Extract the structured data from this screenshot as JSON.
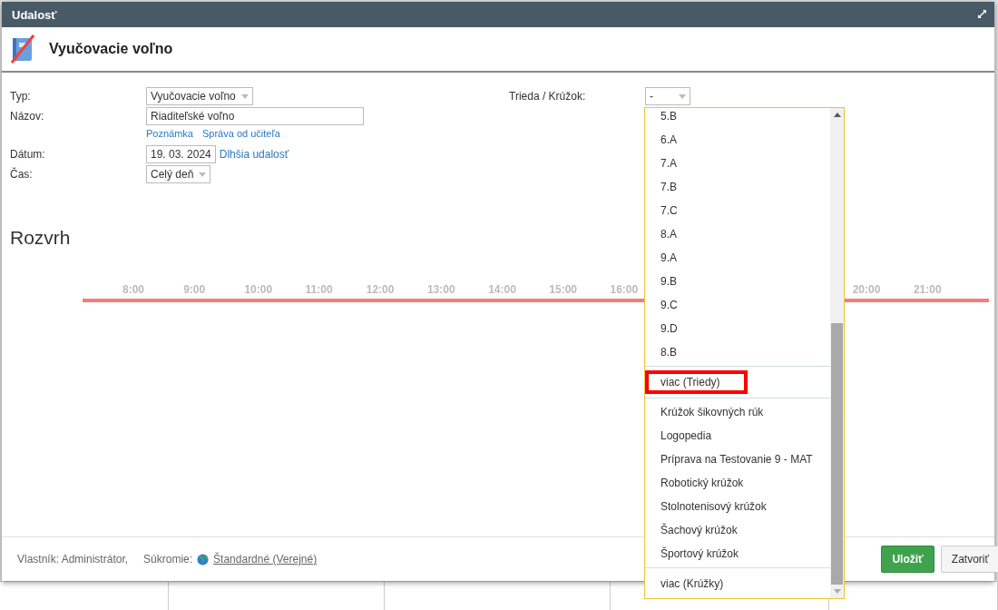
{
  "window": {
    "title": "Udalosť"
  },
  "header": {
    "title": "Vyučovacie voľno"
  },
  "form": {
    "type": {
      "label": "Typ:",
      "value": "Vyučovacie voľno"
    },
    "name": {
      "label": "Názov:",
      "value": "Riaditeľské voľno",
      "links": [
        "Poznámka",
        "Správa od učiteľa"
      ]
    },
    "date": {
      "label": "Dátum:",
      "value": "19. 03. 2024",
      "link": "Dlhšia udalosť"
    },
    "time": {
      "label": "Čas:",
      "value": "Celý deň"
    },
    "class": {
      "label": "Trieda / Krúžok:",
      "value": "-"
    }
  },
  "schedule": {
    "title": "Rozvrh",
    "hours_left": [
      "8:00",
      "9:00",
      "10:00",
      "11:00",
      "12:00",
      "13:00",
      "14:00",
      "15:00",
      "16:00"
    ],
    "hours_right": [
      "20:00",
      "21:00"
    ]
  },
  "dropdown": {
    "groups": [
      {
        "items": [
          "5.B",
          "6.A",
          "7.A",
          "7.B",
          "7.C",
          "8.A",
          "9.A",
          "9.B",
          "9.C",
          "9.D",
          "8.B"
        ],
        "more": {
          "label": "viac (Triedy)",
          "highlighted": true
        }
      },
      {
        "items": [
          "Krúžok šikovných rúk",
          "Logopedia",
          "Príprava na Testovanie 9 - MAT",
          "Robotický krúžok",
          "Stolnotenisový krúžok",
          "Šachový krúžok",
          "Športový krúžok"
        ],
        "more": {
          "label": "viac (Krúžky)",
          "highlighted": false
        }
      }
    ]
  },
  "footer": {
    "owner": "Vlastník: Administrátor,",
    "privacy_label": "Súkromie:",
    "privacy_value": "Štandardné (Verejné)",
    "buttons": [
      {
        "kind": "primary",
        "label": "Uložiť"
      },
      {
        "kind": "secondary",
        "label": "Zatvoriť"
      }
    ]
  }
}
